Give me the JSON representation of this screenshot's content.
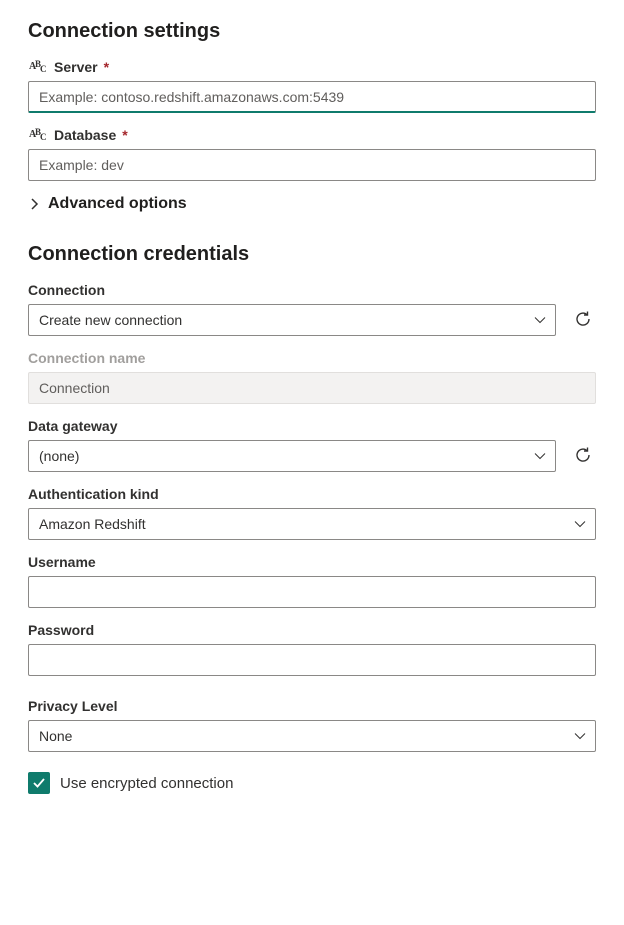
{
  "settings": {
    "title": "Connection settings",
    "server": {
      "label": "Server",
      "placeholder": "Example: contoso.redshift.amazonaws.com:5439",
      "required": "*"
    },
    "database": {
      "label": "Database",
      "placeholder": "Example: dev",
      "required": "*"
    },
    "advanced": {
      "label": "Advanced options"
    }
  },
  "credentials": {
    "title": "Connection credentials",
    "connection": {
      "label": "Connection",
      "value": "Create new connection"
    },
    "connection_name": {
      "label": "Connection name",
      "placeholder": "Connection"
    },
    "data_gateway": {
      "label": "Data gateway",
      "value": "(none)"
    },
    "auth_kind": {
      "label": "Authentication kind",
      "value": "Amazon Redshift"
    },
    "username": {
      "label": "Username",
      "value": ""
    },
    "password": {
      "label": "Password",
      "value": ""
    },
    "privacy": {
      "label": "Privacy Level",
      "value": "None"
    },
    "encrypted": {
      "label": "Use encrypted connection",
      "checked": true
    }
  }
}
